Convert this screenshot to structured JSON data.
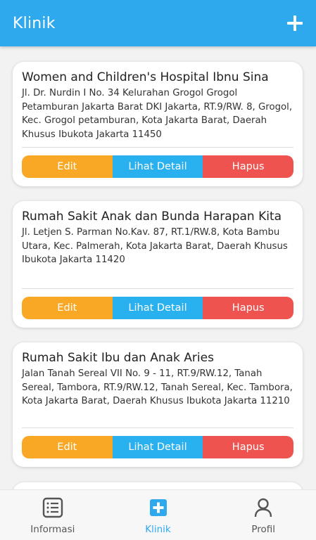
{
  "appbar": {
    "title": "Klinik",
    "add_icon": "plus-icon"
  },
  "colors": {
    "primary": "#2ea9ee",
    "edit": "#f9a825",
    "detail": "#29b0ef",
    "hapus": "#ef5350"
  },
  "actions": {
    "edit_label": "Edit",
    "detail_label": "Lihat Detail",
    "hapus_label": "Hapus"
  },
  "clinics": [
    {
      "name": "Women and Children's Hospital Ibnu Sina",
      "address": "Jl. Dr. Nurdin I No. 34 Kelurahan Grogol Grogol Petamburan Jakarta Barat DKI Jakarta, RT.9/RW. 8, Grogol, Kec. Grogol petamburan, Kota Jakarta Barat, Daerah Khusus Ibukota Jakarta 11450"
    },
    {
      "name": "Rumah Sakit Anak dan Bunda Harapan Kita",
      "address": "Jl. Letjen S. Parman No.Kav. 87, RT.1/RW.8, Kota Bambu Utara, Kec. Palmerah, Kota Jakarta Barat, Daerah Khusus Ibukota Jakarta 11420"
    },
    {
      "name": "Rumah Sakit Ibu dan Anak Aries",
      "address": "Jalan Tanah Sereal VII No. 9 - 11, RT.9/RW.12, Tanah Sereal, Tambora, RT.9/RW.12, Tanah Sereal, Kec. Tambora, Kota Jakarta Barat, Daerah Khusus Ibukota Jakarta 11210"
    }
  ],
  "bottom_nav": {
    "items": [
      {
        "label": "Informasi",
        "icon": "list-icon",
        "active": false
      },
      {
        "label": "Klinik",
        "icon": "medical-plus-icon",
        "active": true
      },
      {
        "label": "Profil",
        "icon": "person-icon",
        "active": false
      }
    ]
  }
}
